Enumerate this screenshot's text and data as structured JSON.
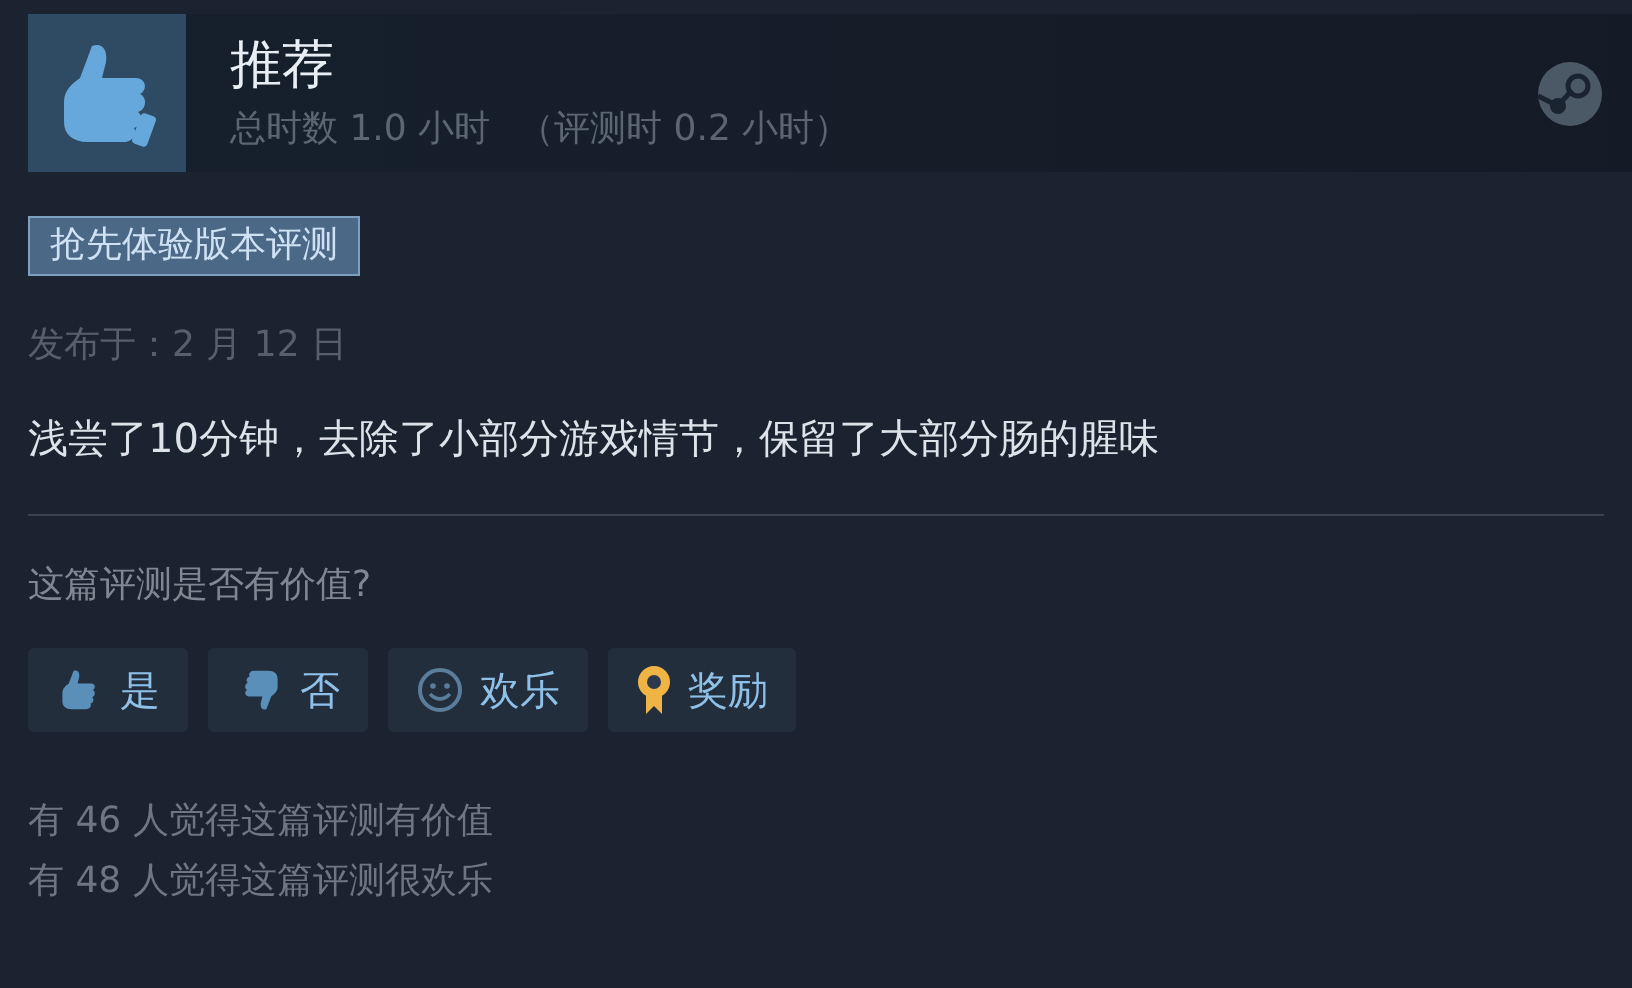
{
  "review": {
    "verdict": "推荐",
    "hours": "总时数 1.0 小时",
    "review_hours": "（评测时 0.2 小时）",
    "tag": "抢先体验版本评测",
    "posted": "发布于：2 月 12 日",
    "text": "浅尝了10分钟，去除了小部分游戏情节，保留了大部分肠的腥味"
  },
  "feedback": {
    "question": "这篇评测是否有价值?",
    "buttons": [
      {
        "kind": "yes",
        "label": "是"
      },
      {
        "kind": "no",
        "label": "否"
      },
      {
        "kind": "funny",
        "label": "欢乐"
      },
      {
        "kind": "award",
        "label": "奖励"
      }
    ],
    "stats": [
      "有 46 人觉得这篇评测有价值",
      "有 48 人觉得这篇评测很欢乐"
    ]
  }
}
